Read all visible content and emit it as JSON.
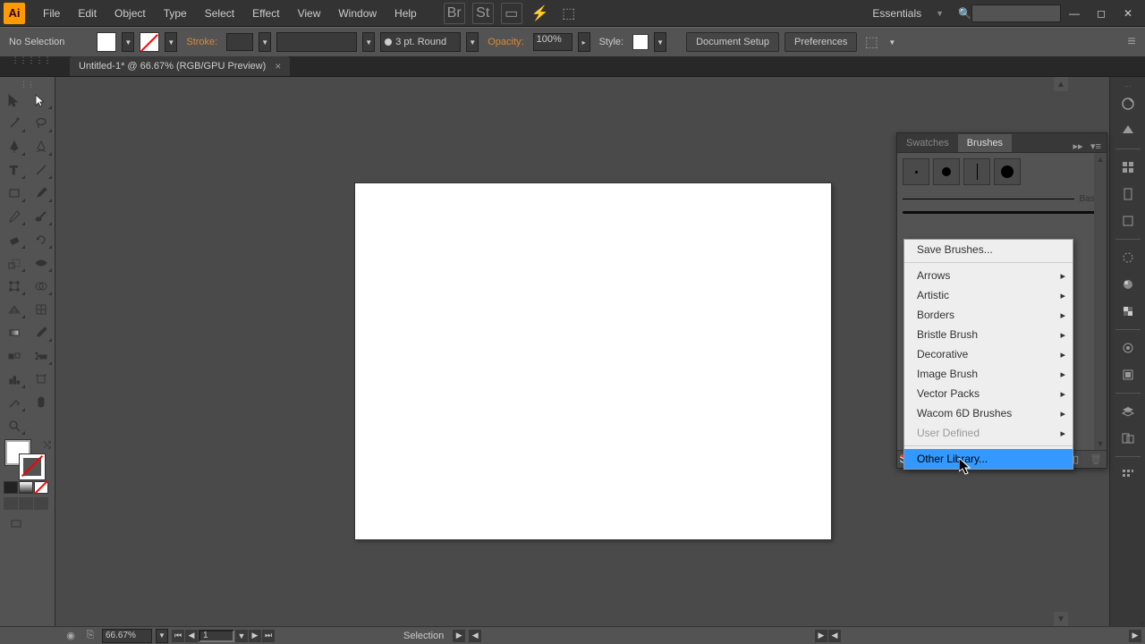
{
  "app": {
    "icon_text": "Ai"
  },
  "menu": {
    "items": [
      "File",
      "Edit",
      "Object",
      "Type",
      "Select",
      "Effect",
      "View",
      "Window",
      "Help"
    ]
  },
  "workspace_switcher": {
    "label": "Essentials"
  },
  "window_controls": {
    "min": "—",
    "max": "◻",
    "close": "✕"
  },
  "controlbar": {
    "selection": "No Selection",
    "stroke_label": "Stroke:",
    "stroke_weight": "",
    "brush": "3 pt. Round",
    "opacity_label": "Opacity:",
    "opacity_value": "100%",
    "style_label": "Style:",
    "doc_setup": "Document Setup",
    "preferences": "Preferences"
  },
  "document": {
    "tab_title": "Untitled-1* @ 66.67% (RGB/GPU Preview)",
    "tab_close": "×"
  },
  "status": {
    "zoom": "66.67%",
    "artboard": "1",
    "tool": "Selection"
  },
  "panel": {
    "tabs": [
      "Swatches",
      "Brushes"
    ],
    "active_tab": 1,
    "basic_label": "Basic"
  },
  "context_menu": {
    "items": [
      {
        "label": "Save Brushes...",
        "sub": false,
        "disabled": false
      },
      {
        "sep": true
      },
      {
        "label": "Arrows",
        "sub": true
      },
      {
        "label": "Artistic",
        "sub": true
      },
      {
        "label": "Borders",
        "sub": true
      },
      {
        "label": "Bristle Brush",
        "sub": true
      },
      {
        "label": "Decorative",
        "sub": true
      },
      {
        "label": "Image Brush",
        "sub": true
      },
      {
        "label": "Vector Packs",
        "sub": true
      },
      {
        "label": "Wacom 6D Brushes",
        "sub": true
      },
      {
        "label": "User Defined",
        "sub": true,
        "disabled": true
      },
      {
        "sep": true
      },
      {
        "label": "Other Library...",
        "sub": false,
        "highlighted": true
      }
    ]
  },
  "tools": {
    "rows": [
      [
        "selection",
        "direct-selection"
      ],
      [
        "magic-wand",
        "lasso"
      ],
      [
        "pen",
        "curvature"
      ],
      [
        "type",
        "line"
      ],
      [
        "rectangle",
        "paintbrush"
      ],
      [
        "pencil",
        "blob-brush"
      ],
      [
        "eraser",
        "rotate"
      ],
      [
        "scale",
        "width"
      ],
      [
        "free-transform",
        "shape-builder"
      ],
      [
        "perspective",
        "mesh"
      ],
      [
        "gradient",
        "eyedropper"
      ],
      [
        "blend",
        "symbol-sprayer"
      ],
      [
        "column-graph",
        "artboard"
      ],
      [
        "slice",
        "hand"
      ],
      [
        "zoom",
        ""
      ]
    ]
  },
  "dock_icons": [
    "color",
    "color-guide",
    "swatches",
    "brushes",
    "symbols",
    "stroke",
    "gradient",
    "transparency",
    "appearance",
    "graphic-styles",
    "layers",
    "artboards",
    "align"
  ]
}
